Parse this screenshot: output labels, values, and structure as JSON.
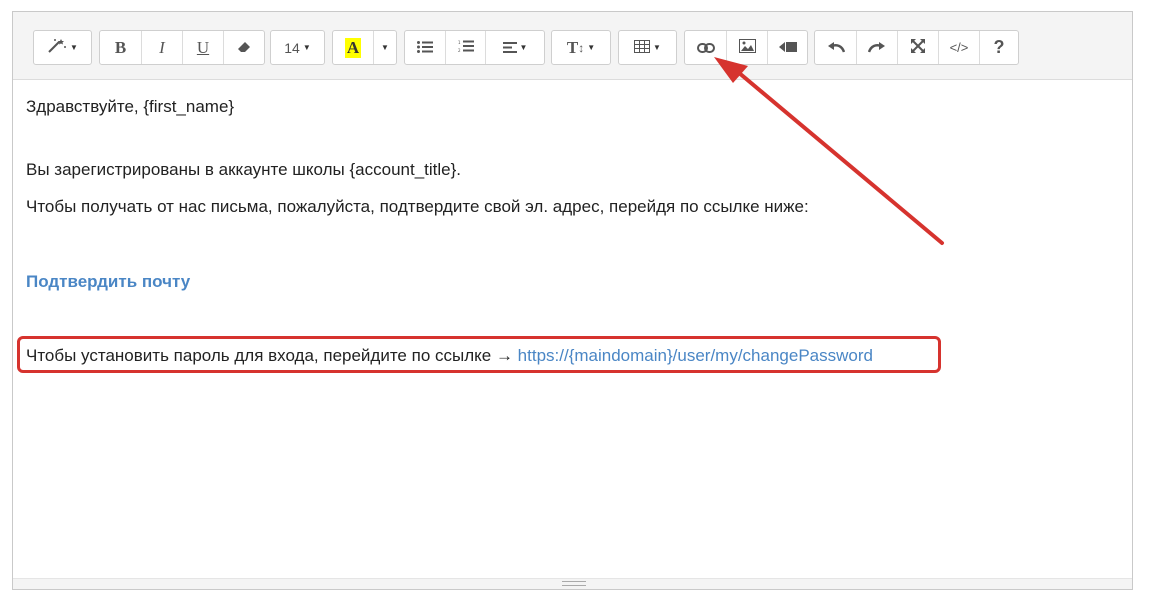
{
  "toolbar": {
    "font_size_label": "14",
    "bold_label": "B",
    "italic_label": "I",
    "underline_label": "U",
    "text_color_label": "A",
    "text_style_label": "T",
    "help_label": "?",
    "code_label": "</>",
    "highlight_color": "#ffff00"
  },
  "content": {
    "greeting": "Здравствуйте, {first_name}",
    "registered": "Вы зарегистрированы в  аккаунте школы {account_title}.",
    "confirm_instruction": "Чтобы получать от нас письма, пожалуйста, подтвердите свой эл. адрес, перейдя по ссылке ниже:",
    "confirm_link": "Подтвердить почту",
    "password_text": "Чтобы установить пароль для входа, перейдите по ссылке → ",
    "password_link": "https://{maindomain}/user/my/changePassword"
  },
  "annotations": {
    "color": "#d6332e"
  }
}
